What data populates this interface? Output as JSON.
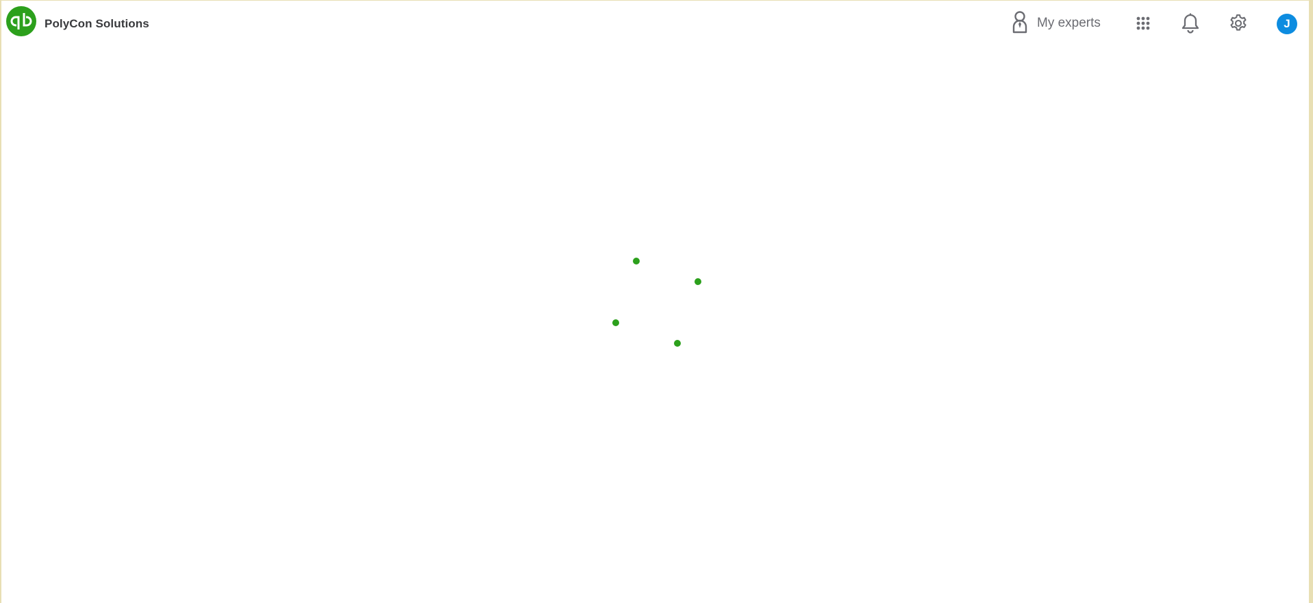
{
  "header": {
    "company_name": "PolyCon Solutions",
    "logo_icon": "quickbooks-logo",
    "my_experts_label": "My experts",
    "apps_icon": "apps-grid-icon",
    "notifications_icon": "bell-icon",
    "settings_icon": "gear-icon",
    "avatar_initial": "J"
  },
  "loader": {
    "icon": "loading-spinner",
    "dot_color": "#2ca01c"
  },
  "colors": {
    "brand_green": "#2ca01c",
    "avatar_blue": "#0d8ce0",
    "text_dark": "#393a3d",
    "text_muted": "#6b6c72",
    "frame_border": "#e8dfb4"
  }
}
